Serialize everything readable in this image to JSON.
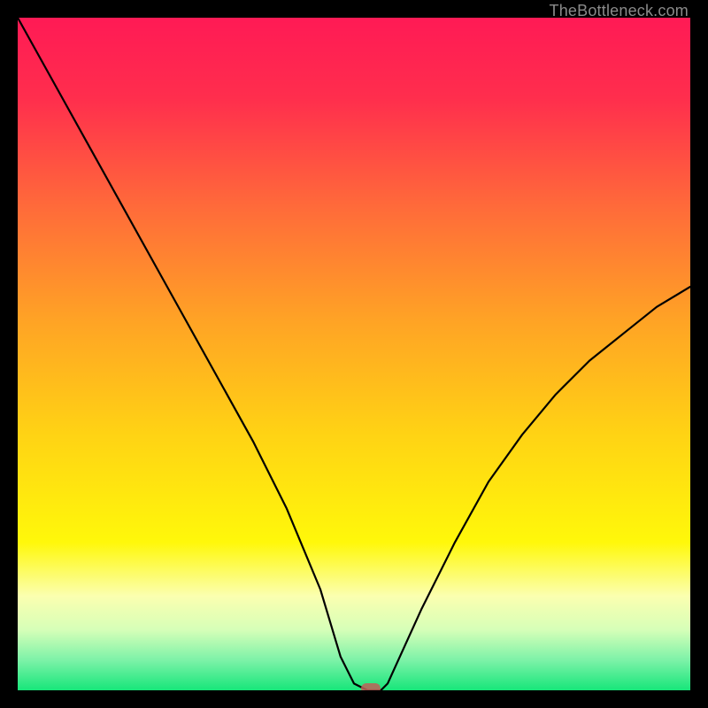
{
  "credit": "TheBottleneck.com",
  "chart_data": {
    "type": "line",
    "title": "",
    "xlabel": "",
    "ylabel": "",
    "xlim": [
      0,
      100
    ],
    "ylim": [
      0,
      100
    ],
    "grid": false,
    "legend": false,
    "x": [
      0,
      5,
      10,
      15,
      20,
      25,
      30,
      35,
      40,
      45,
      48,
      50,
      52,
      54,
      55,
      60,
      65,
      70,
      75,
      80,
      85,
      90,
      95,
      100
    ],
    "values": [
      100,
      91,
      82,
      73,
      64,
      55,
      46,
      37,
      27,
      15,
      5,
      1,
      0,
      0,
      1,
      12,
      22,
      31,
      38,
      44,
      49,
      53,
      57,
      60
    ],
    "marker": {
      "x": 52.5,
      "y": 0
    },
    "gradient_stops": [
      {
        "pos": 0.0,
        "color": "#ff1a55"
      },
      {
        "pos": 0.12,
        "color": "#ff2e4d"
      },
      {
        "pos": 0.28,
        "color": "#ff6a3a"
      },
      {
        "pos": 0.45,
        "color": "#ffa325"
      },
      {
        "pos": 0.62,
        "color": "#ffd314"
      },
      {
        "pos": 0.78,
        "color": "#fff80a"
      },
      {
        "pos": 0.86,
        "color": "#fbffb0"
      },
      {
        "pos": 0.91,
        "color": "#d6ffb8"
      },
      {
        "pos": 0.955,
        "color": "#7df2a8"
      },
      {
        "pos": 1.0,
        "color": "#17e67a"
      }
    ]
  }
}
